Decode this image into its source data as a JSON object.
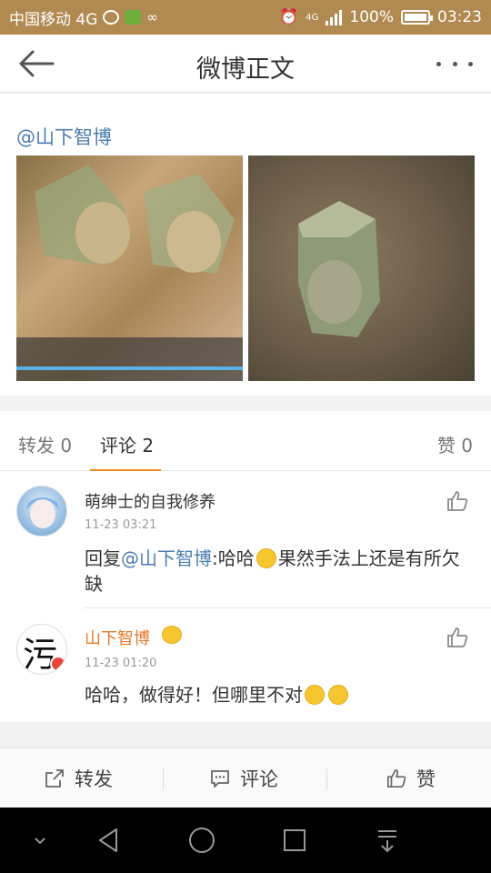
{
  "status_bar": {
    "carrier": "中国移动 4G",
    "network": "4G",
    "battery": "100%",
    "time": "03:23"
  },
  "nav": {
    "title": "微博正文"
  },
  "post": {
    "author": "@山下智博"
  },
  "tabs": {
    "repost": "转发 0",
    "comment": "评论 2",
    "like": "赞 0"
  },
  "comments": [
    {
      "name": "萌绅士的自我修养",
      "time": "11-23 03:21",
      "prefix": "回复",
      "mention": "@山下智博",
      "text_a": ":哈哈",
      "text_b": "果然手法上还是有所欠缺"
    },
    {
      "name": "山下智博",
      "time": "11-23 01:20",
      "text": "哈哈，做得好！但哪里不对"
    }
  ],
  "bottom_bar": {
    "repost": "转发",
    "comment": "评论",
    "like": "赞"
  },
  "avatar_glyph": "污",
  "colors": {
    "status_bar": "#b08a51",
    "accent": "#f08b1a",
    "link": "#4a7db0",
    "vip_name": "#e8782a"
  }
}
